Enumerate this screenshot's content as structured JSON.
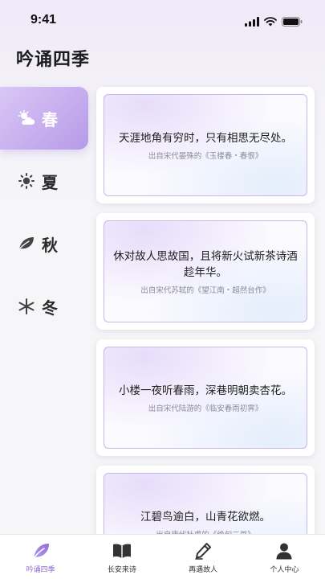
{
  "status_bar": {
    "time": "9:41"
  },
  "app": {
    "title": "吟诵四季"
  },
  "seasons": [
    {
      "label": "春",
      "icon": "sun-cloud-icon",
      "active": true
    },
    {
      "label": "夏",
      "icon": "sun-icon",
      "active": false
    },
    {
      "label": "秋",
      "icon": "leaf-icon",
      "active": false
    },
    {
      "label": "冬",
      "icon": "snowflake-icon",
      "active": false
    }
  ],
  "poems": [
    {
      "text": "天涯地角有穷时，只有相思无尽处。",
      "source": "出自宋代晏殊的《玉楼春・春恨》"
    },
    {
      "text": "休对故人思故国，且将新火试新茶诗酒趁年华。",
      "source": "出自宋代苏轼的《望江南・超然台作》"
    },
    {
      "text": "小楼一夜听春雨，深巷明朝卖杏花。",
      "source": "出自宋代陆游的《临安春雨初霁》"
    },
    {
      "text": "江碧鸟逾白，山青花欲燃。",
      "source": "出自唐代杜甫的《绝句二首》"
    }
  ],
  "bottom_nav": [
    {
      "label": "吟诵四季",
      "icon": "leaf-icon",
      "active": true
    },
    {
      "label": "长安来诗",
      "icon": "book-icon",
      "active": false
    },
    {
      "label": "再遇故人",
      "icon": "pen-icon",
      "active": false
    },
    {
      "label": "个人中心",
      "icon": "person-icon",
      "active": false
    }
  ],
  "colors": {
    "accent": "#8e6fd6",
    "active_gradient_start": "#d9c7f5",
    "active_gradient_end": "#b79ae8",
    "card_border": "#c8b7ec"
  }
}
